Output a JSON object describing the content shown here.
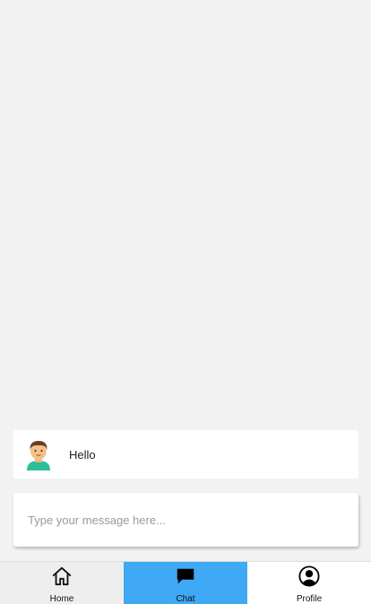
{
  "messages": [
    {
      "avatar": "man-emoji-avatar",
      "text": "Hello"
    }
  ],
  "composer": {
    "placeholder": "Type your message here..."
  },
  "nav": {
    "items": [
      {
        "label": "Home",
        "icon": "home-icon"
      },
      {
        "label": "Chat",
        "icon": "chat-icon",
        "active": true
      },
      {
        "label": "Profile",
        "icon": "profile-icon"
      }
    ],
    "active_color": "#3fa9f5"
  }
}
